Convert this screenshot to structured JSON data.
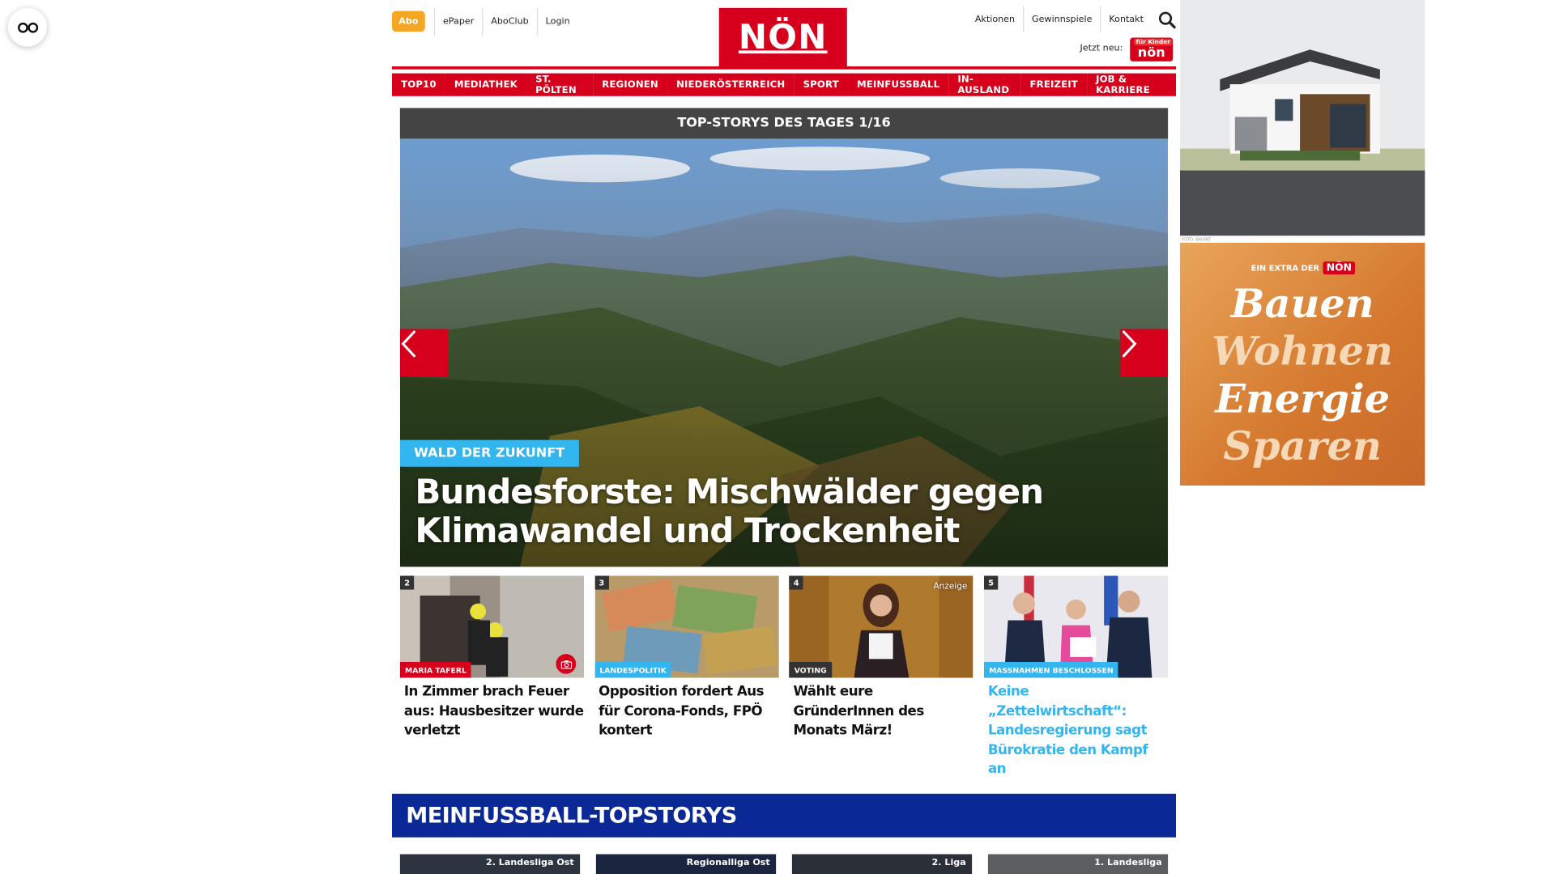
{
  "header": {
    "abo_label": "Abo",
    "left_links": [
      "ePaper",
      "AboClub",
      "Login"
    ],
    "right_links": [
      "Aktionen",
      "Gewinnspiele",
      "Kontakt"
    ],
    "logo_text": "NÖN",
    "jetzt_neu": "Jetzt neu:",
    "mini_logo_text": "nön",
    "mini_logo_small": "für Kinder"
  },
  "categories": [
    "TOP10",
    "MEDIATHEK",
    "ST. PÖLTEN",
    "REGIONEN",
    "NIEDERÖSTERREICH",
    "SPORT",
    "MEINFUSSBALL",
    "IN-AUSLAND",
    "FREIZEIT",
    "JOB & KARRIERE"
  ],
  "top_stories": {
    "header": "TOP-STORYS DES TAGES 1/16",
    "hero_tag": "WALD DER ZUKUNFT",
    "hero_title": "Bundesforste: Mischwälder gegen Klimawandel und Trockenheit"
  },
  "teasers": [
    {
      "num": "2",
      "tag": "MARIA TAFERL",
      "title": "In Zimmer brach Feuer aus: Hausbesitzer wurde verletzt"
    },
    {
      "num": "3",
      "tag": "LANDESPOLITIK",
      "title": "Opposition fordert Aus für Corona-Fonds, FPÖ kontert"
    },
    {
      "num": "4",
      "tag": "VOTING",
      "anzeige": "Anzeige",
      "title": "Wählt eure GründerInnen des Monats März!"
    },
    {
      "num": "5",
      "tag": "MASSNAHMEN BESCHLOSSEN",
      "title": "Keine „Zettelwirtschaft“: Landesregierung sagt Bürokratie den Kampf an"
    }
  ],
  "meinfussball": {
    "header": "MEINFUSSBALL-TOPSTORYS",
    "leagues": [
      "2. Landesliga Ost",
      "Regionalliga Ost",
      "2. Liga",
      "1. Landesliga"
    ]
  },
  "ads": {
    "photo_credit": "FOTO: BAUMIT",
    "extra_label": "EIN EXTRA DER",
    "extra_badge": "NÖN",
    "words": [
      "Bauen",
      "Wohnen",
      "Energie",
      "Sparen"
    ]
  },
  "colors": {
    "brand_red": "#d6001c",
    "abo_orange": "#f5a623",
    "tag_blue": "#33b5f0",
    "fussball_blue": "#0a2896",
    "ts_header_gray": "#444444"
  }
}
